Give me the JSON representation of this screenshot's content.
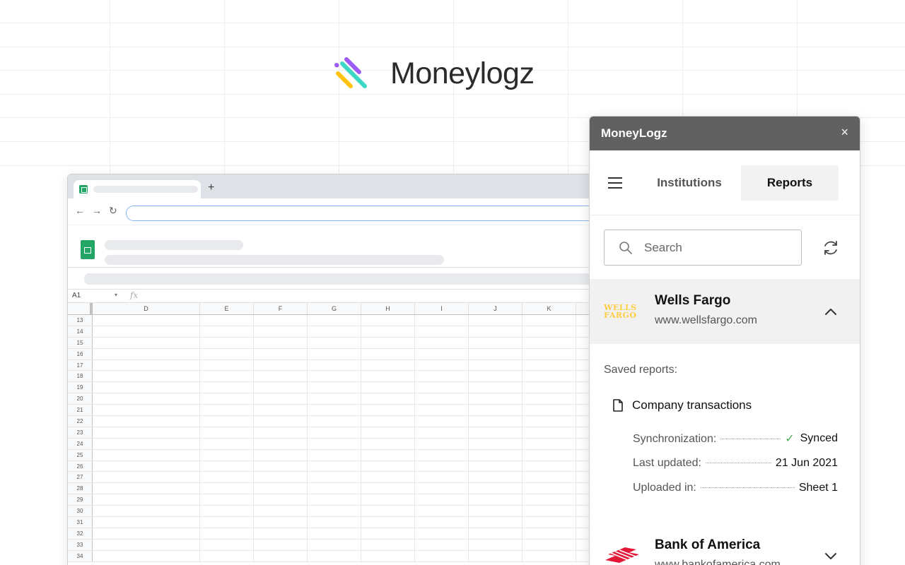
{
  "brand": {
    "name": "Moneylogz"
  },
  "browser": {
    "new_tab_symbol": "+",
    "back_symbol": "←",
    "forward_symbol": "→",
    "reload_symbol": "↻"
  },
  "spreadsheet": {
    "cell_reference": "A1",
    "formula_symbol": "fx",
    "columns": [
      "D",
      "E",
      "F",
      "G",
      "H",
      "I",
      "J",
      "K"
    ],
    "rows": [
      "13",
      "14",
      "15",
      "16",
      "17",
      "18",
      "19",
      "20",
      "21",
      "22",
      "23",
      "24",
      "25",
      "26",
      "27",
      "28",
      "29",
      "30",
      "31",
      "32",
      "33",
      "34"
    ]
  },
  "panel": {
    "title": "MoneyLogz",
    "close_symbol": "×",
    "tabs": [
      {
        "label": "Institutions",
        "active": false
      },
      {
        "label": "Reports",
        "active": true
      }
    ],
    "search": {
      "placeholder": "Search"
    },
    "institutions": [
      {
        "name": "Wells Fargo",
        "url": "www.wellsfargo.com",
        "logo_text": "WELLS FARGO",
        "logo_line1": "WELLS",
        "logo_line2": "FARGO",
        "expanded": true,
        "saved_reports_label": "Saved reports:",
        "reports": [
          {
            "name": "Company transactions",
            "details": [
              {
                "key": "Synchronization:",
                "value": "Synced",
                "status_icon": "check-icon"
              },
              {
                "key": "Last updated:",
                "value": "21 Jun 2021"
              },
              {
                "key": "Uploaded in:",
                "value": "Sheet 1"
              }
            ]
          }
        ]
      },
      {
        "name": "Bank of America",
        "url": "www.bankofamerica.com",
        "expanded": false
      }
    ]
  },
  "colors": {
    "titlebar": "#616161",
    "wells_fargo_gold": "#ffcd41",
    "bofa_red": "#e31837",
    "synced_green": "#4caf50",
    "sheets_green": "#23a566"
  }
}
